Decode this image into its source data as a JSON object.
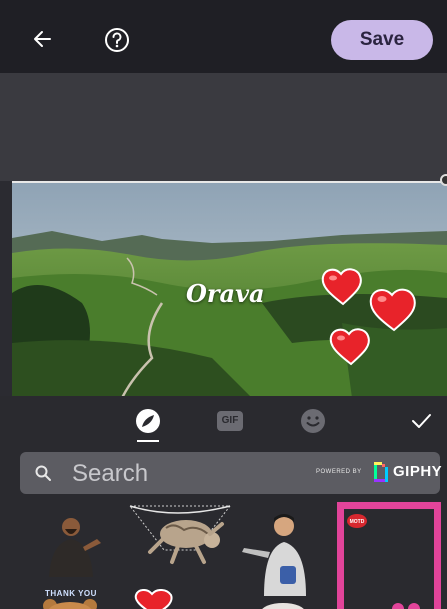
{
  "topbar": {
    "back_icon": "arrow-left-icon",
    "help_icon": "question-circle-icon",
    "save_label": "Save",
    "save_color": "#c9b8e8"
  },
  "canvas": {
    "text_overlay": "Orava",
    "heart_color": "#e8232a"
  },
  "sticker_tabs": [
    {
      "name": "stickers",
      "icon": "sticker-icon",
      "selected": true
    },
    {
      "name": "gif",
      "label": "GIF",
      "selected": false
    },
    {
      "name": "emoji",
      "icon": "smiley-icon",
      "selected": false
    }
  ],
  "done_icon": "checkmark-icon",
  "search": {
    "placeholder": "Search",
    "powered_by": "POWERED BY",
    "provider": "GIPHY"
  },
  "stickers": [
    {
      "name": "man-sticker"
    },
    {
      "name": "flying-cat-sticker"
    },
    {
      "name": "man-with-knife-sticker"
    },
    {
      "name": "pink-frame-sticker",
      "badge": "MOTD"
    },
    {
      "name": "thank-you-bear-sticker",
      "text": "THANK YOU"
    },
    {
      "name": "heart-sticker"
    }
  ]
}
